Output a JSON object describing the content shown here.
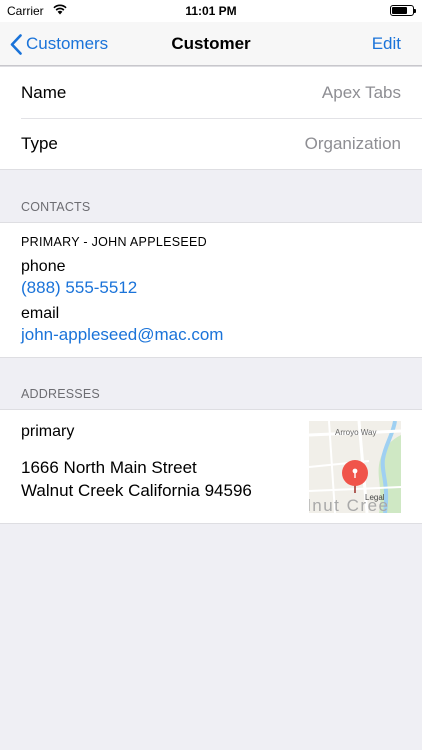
{
  "status_bar": {
    "carrier": "Carrier",
    "time": "11:01 PM"
  },
  "nav": {
    "back_label": "Customers",
    "title": "Customer",
    "edit_label": "Edit"
  },
  "details": [
    {
      "label": "Name",
      "value": "Apex Tabs"
    },
    {
      "label": "Type",
      "value": "Organization"
    }
  ],
  "contacts": {
    "header": "CONTACTS",
    "primary_name": "PRIMARY - JOHN APPLESEED",
    "phone_label": "phone",
    "phone_value": "(888) 555-5512",
    "email_label": "email",
    "email_value": "john-appleseed@mac.com"
  },
  "addresses": {
    "header": "ADDRESSES",
    "kind": "primary",
    "line1": "1666 North Main Street",
    "line2": "Walnut Creek California 94596",
    "map": {
      "street_label": "Arroyo Way",
      "city_label": "lnut Cree",
      "legal_label": "Legal"
    }
  },
  "colors": {
    "accent": "#1a73d9",
    "pin": "#f0544a",
    "background": "#efeff4"
  }
}
